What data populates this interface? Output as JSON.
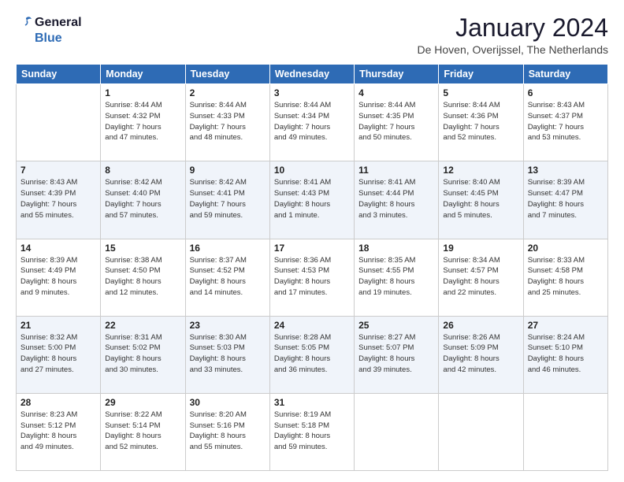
{
  "logo": {
    "line1": "General",
    "line2": "Blue"
  },
  "title": "January 2024",
  "subtitle": "De Hoven, Overijssel, The Netherlands",
  "header_days": [
    "Sunday",
    "Monday",
    "Tuesday",
    "Wednesday",
    "Thursday",
    "Friday",
    "Saturday"
  ],
  "weeks": [
    [
      {
        "day": "",
        "info": ""
      },
      {
        "day": "1",
        "info": "Sunrise: 8:44 AM\nSunset: 4:32 PM\nDaylight: 7 hours\nand 47 minutes."
      },
      {
        "day": "2",
        "info": "Sunrise: 8:44 AM\nSunset: 4:33 PM\nDaylight: 7 hours\nand 48 minutes."
      },
      {
        "day": "3",
        "info": "Sunrise: 8:44 AM\nSunset: 4:34 PM\nDaylight: 7 hours\nand 49 minutes."
      },
      {
        "day": "4",
        "info": "Sunrise: 8:44 AM\nSunset: 4:35 PM\nDaylight: 7 hours\nand 50 minutes."
      },
      {
        "day": "5",
        "info": "Sunrise: 8:44 AM\nSunset: 4:36 PM\nDaylight: 7 hours\nand 52 minutes."
      },
      {
        "day": "6",
        "info": "Sunrise: 8:43 AM\nSunset: 4:37 PM\nDaylight: 7 hours\nand 53 minutes."
      }
    ],
    [
      {
        "day": "7",
        "info": "Sunrise: 8:43 AM\nSunset: 4:39 PM\nDaylight: 7 hours\nand 55 minutes."
      },
      {
        "day": "8",
        "info": "Sunrise: 8:42 AM\nSunset: 4:40 PM\nDaylight: 7 hours\nand 57 minutes."
      },
      {
        "day": "9",
        "info": "Sunrise: 8:42 AM\nSunset: 4:41 PM\nDaylight: 7 hours\nand 59 minutes."
      },
      {
        "day": "10",
        "info": "Sunrise: 8:41 AM\nSunset: 4:43 PM\nDaylight: 8 hours\nand 1 minute."
      },
      {
        "day": "11",
        "info": "Sunrise: 8:41 AM\nSunset: 4:44 PM\nDaylight: 8 hours\nand 3 minutes."
      },
      {
        "day": "12",
        "info": "Sunrise: 8:40 AM\nSunset: 4:45 PM\nDaylight: 8 hours\nand 5 minutes."
      },
      {
        "day": "13",
        "info": "Sunrise: 8:39 AM\nSunset: 4:47 PM\nDaylight: 8 hours\nand 7 minutes."
      }
    ],
    [
      {
        "day": "14",
        "info": "Sunrise: 8:39 AM\nSunset: 4:49 PM\nDaylight: 8 hours\nand 9 minutes."
      },
      {
        "day": "15",
        "info": "Sunrise: 8:38 AM\nSunset: 4:50 PM\nDaylight: 8 hours\nand 12 minutes."
      },
      {
        "day": "16",
        "info": "Sunrise: 8:37 AM\nSunset: 4:52 PM\nDaylight: 8 hours\nand 14 minutes."
      },
      {
        "day": "17",
        "info": "Sunrise: 8:36 AM\nSunset: 4:53 PM\nDaylight: 8 hours\nand 17 minutes."
      },
      {
        "day": "18",
        "info": "Sunrise: 8:35 AM\nSunset: 4:55 PM\nDaylight: 8 hours\nand 19 minutes."
      },
      {
        "day": "19",
        "info": "Sunrise: 8:34 AM\nSunset: 4:57 PM\nDaylight: 8 hours\nand 22 minutes."
      },
      {
        "day": "20",
        "info": "Sunrise: 8:33 AM\nSunset: 4:58 PM\nDaylight: 8 hours\nand 25 minutes."
      }
    ],
    [
      {
        "day": "21",
        "info": "Sunrise: 8:32 AM\nSunset: 5:00 PM\nDaylight: 8 hours\nand 27 minutes."
      },
      {
        "day": "22",
        "info": "Sunrise: 8:31 AM\nSunset: 5:02 PM\nDaylight: 8 hours\nand 30 minutes."
      },
      {
        "day": "23",
        "info": "Sunrise: 8:30 AM\nSunset: 5:03 PM\nDaylight: 8 hours\nand 33 minutes."
      },
      {
        "day": "24",
        "info": "Sunrise: 8:28 AM\nSunset: 5:05 PM\nDaylight: 8 hours\nand 36 minutes."
      },
      {
        "day": "25",
        "info": "Sunrise: 8:27 AM\nSunset: 5:07 PM\nDaylight: 8 hours\nand 39 minutes."
      },
      {
        "day": "26",
        "info": "Sunrise: 8:26 AM\nSunset: 5:09 PM\nDaylight: 8 hours\nand 42 minutes."
      },
      {
        "day": "27",
        "info": "Sunrise: 8:24 AM\nSunset: 5:10 PM\nDaylight: 8 hours\nand 46 minutes."
      }
    ],
    [
      {
        "day": "28",
        "info": "Sunrise: 8:23 AM\nSunset: 5:12 PM\nDaylight: 8 hours\nand 49 minutes."
      },
      {
        "day": "29",
        "info": "Sunrise: 8:22 AM\nSunset: 5:14 PM\nDaylight: 8 hours\nand 52 minutes."
      },
      {
        "day": "30",
        "info": "Sunrise: 8:20 AM\nSunset: 5:16 PM\nDaylight: 8 hours\nand 55 minutes."
      },
      {
        "day": "31",
        "info": "Sunrise: 8:19 AM\nSunset: 5:18 PM\nDaylight: 8 hours\nand 59 minutes."
      },
      {
        "day": "",
        "info": ""
      },
      {
        "day": "",
        "info": ""
      },
      {
        "day": "",
        "info": ""
      }
    ]
  ]
}
